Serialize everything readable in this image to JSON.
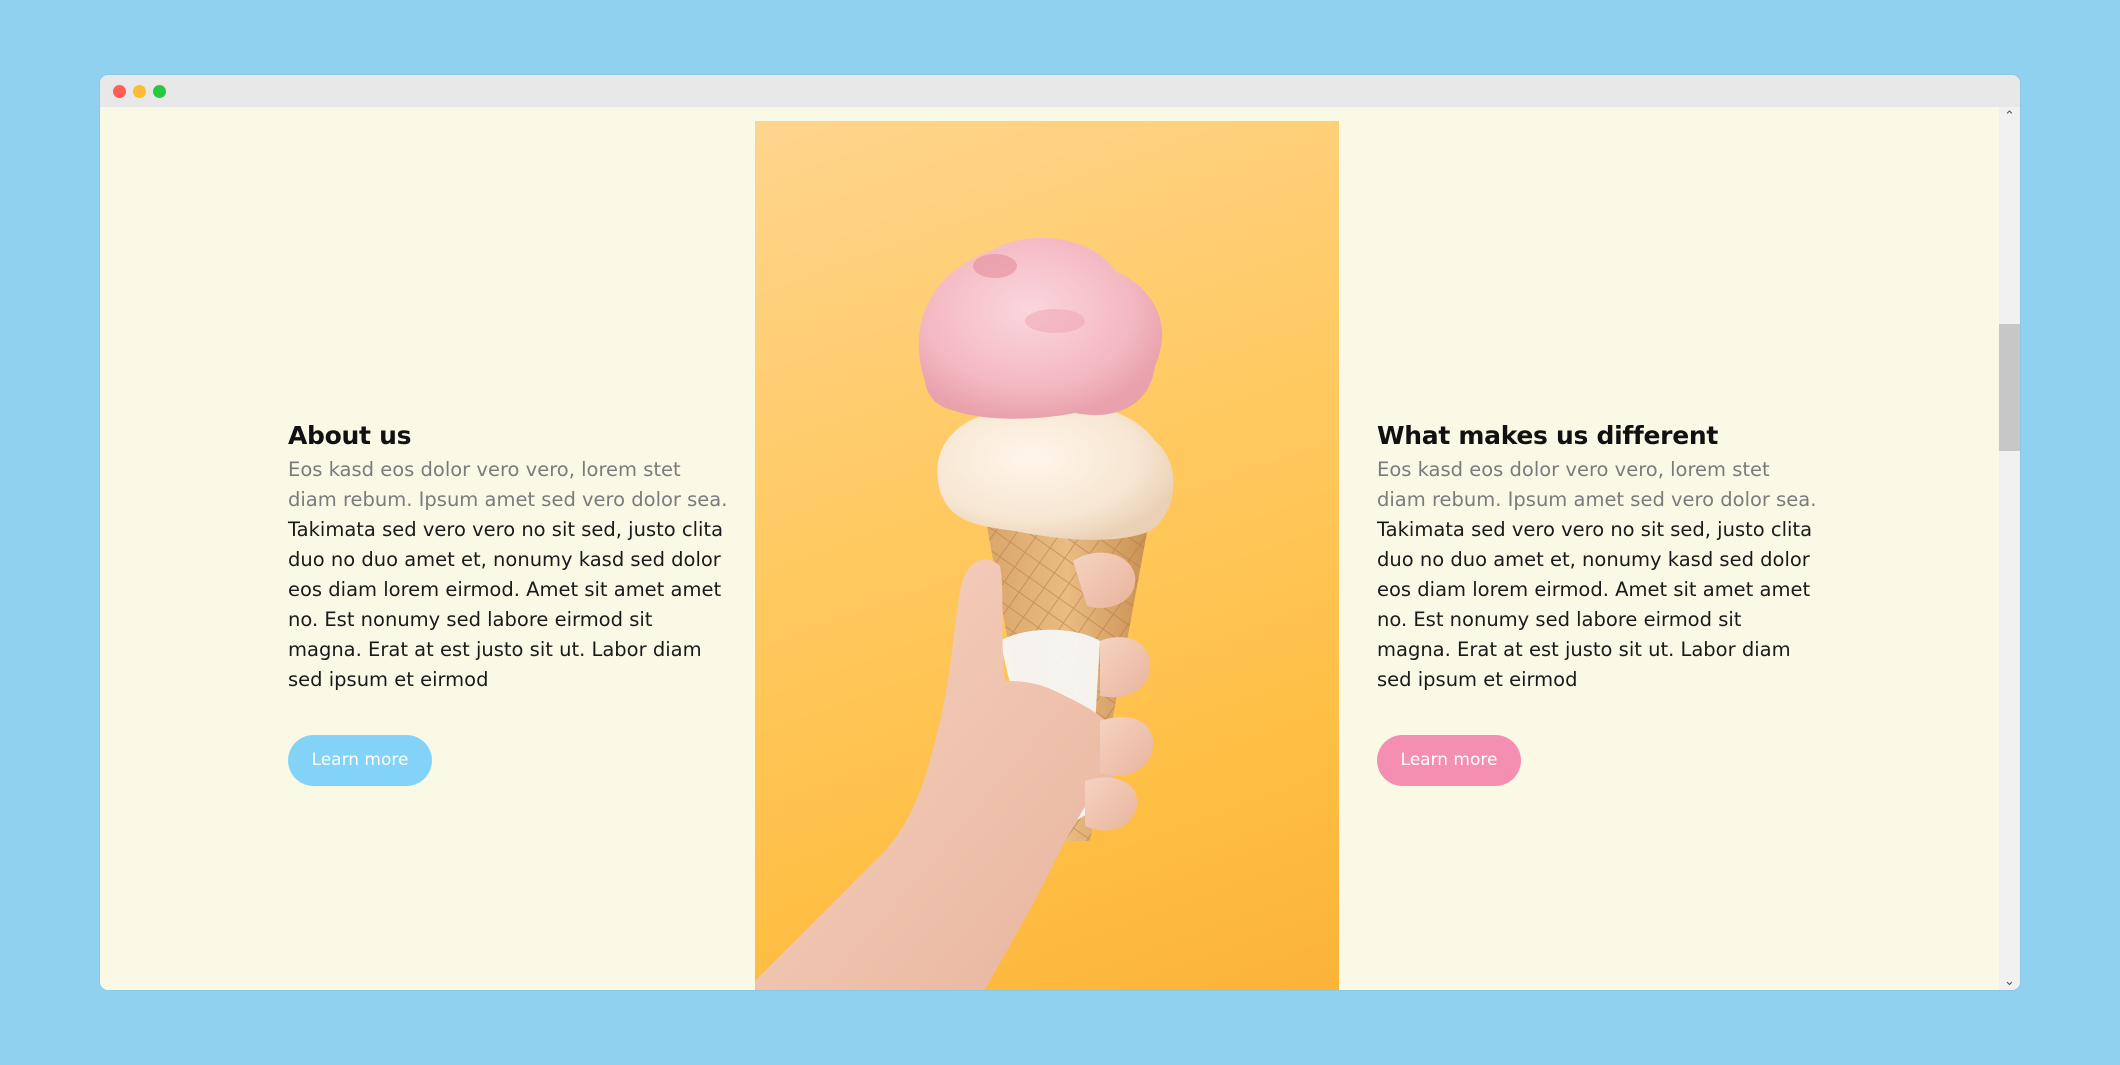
{
  "sections": {
    "about": {
      "heading": "About us",
      "lead": "Eos kasd eos dolor vero vero, lorem stet diam rebum. Ipsum amet sed vero dolor sea.",
      "body": "Takimata sed vero vero no sit sed, justo clita duo no duo amet et, nonumy kasd sed dolor eos diam lorem eirmod. Amet sit amet amet no. Est nonumy sed labore eirmod sit magna. Erat at est justo sit ut. Labor diam sed ipsum et eirmod",
      "button_label": "Learn more"
    },
    "different": {
      "heading": "What makes us different",
      "lead": "Eos kasd eos dolor vero vero, lorem stet diam rebum. Ipsum amet sed vero dolor sea.",
      "body": "Takimata sed vero vero no sit sed, justo clita duo no duo amet et, nonumy kasd sed dolor eos diam lorem eirmod. Amet sit amet amet no. Est nonumy sed labore eirmod sit magna. Erat at est justo sit ut. Labor diam sed ipsum et eirmod",
      "button_label": "Learn more"
    }
  },
  "colors": {
    "page_background": "#90d1ef",
    "window_background": "#f9f9e6",
    "button_blue": "#82d3f7",
    "button_pink": "#f48fb1",
    "photo_background": "#ffc75a"
  },
  "icons": {
    "scroll_up": "chevron-up-icon",
    "scroll_down": "chevron-down-icon"
  }
}
